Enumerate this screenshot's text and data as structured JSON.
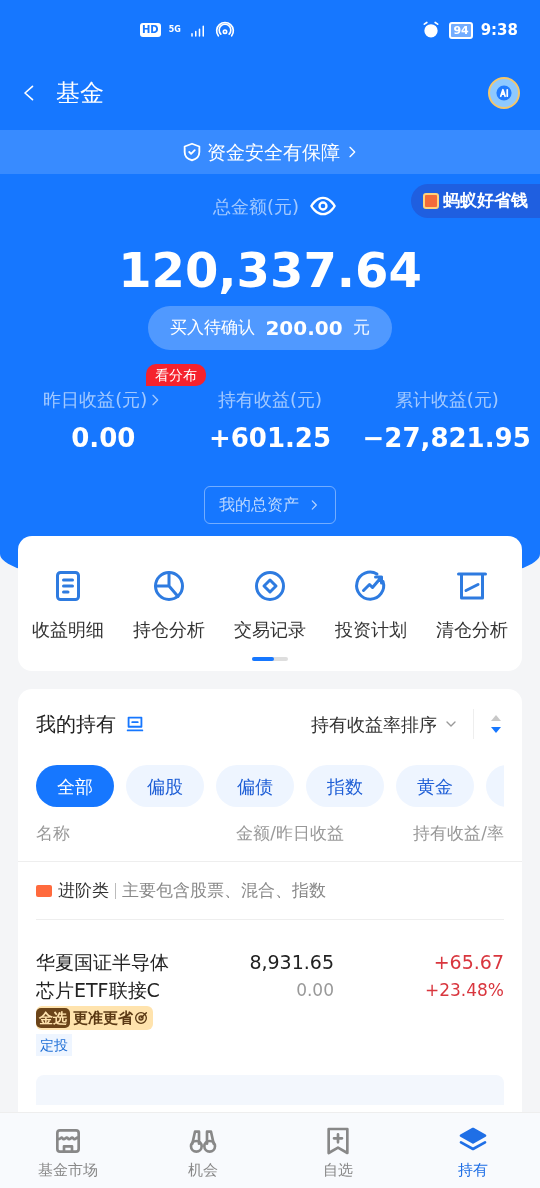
{
  "status_bar": {
    "hd": "HD",
    "network": "5G",
    "battery": "94",
    "time": "9:38"
  },
  "header": {
    "title": "基金"
  },
  "security_banner": {
    "label": "资金安全有保障"
  },
  "summary": {
    "total_label": "总金额(元)",
    "promo": "蚂蚁好省钱",
    "total": "120,337.64",
    "pending_label": "买入待确认",
    "pending_amount": "200.00",
    "pending_unit": "元",
    "badge": "看分布",
    "stats": [
      {
        "label": "昨日收益(元)",
        "value": "0.00",
        "link": true
      },
      {
        "label": "持有收益(元)",
        "value": "+601.25",
        "link": false
      },
      {
        "label": "累计收益(元)",
        "value": "−27,821.95",
        "link": false
      }
    ],
    "assets_button": "我的总资产"
  },
  "shortcuts": [
    {
      "label": "收益明细"
    },
    {
      "label": "持仓分析"
    },
    {
      "label": "交易记录"
    },
    {
      "label": "投资计划"
    },
    {
      "label": "清仓分析"
    }
  ],
  "shortcut_pager": {
    "level": 0.6
  },
  "holdings": {
    "title": "我的持有",
    "sort_label": "持有收益率排序",
    "filters": [
      {
        "label": "全部",
        "selected": true
      },
      {
        "label": "偏股",
        "selected": false
      },
      {
        "label": "偏债",
        "selected": false
      },
      {
        "label": "指数",
        "selected": false
      },
      {
        "label": "黄金",
        "selected": false
      }
    ],
    "columns": [
      "名称",
      "金额/昨日收益",
      "持有收益/率"
    ],
    "category": {
      "name": "进阶类",
      "description": "主要包含股票、混合、指数"
    },
    "funds": [
      {
        "name": "华夏国证半导体芯片ETF联接C",
        "amount": "8,931.65",
        "yesterday": "0.00",
        "profit": "+65.67",
        "rate": "+23.48%",
        "promo_tag": "金选",
        "promo_text": "更准更省",
        "plan_tag": "定投"
      }
    ]
  },
  "bottom_nav": [
    {
      "label": "基金市场",
      "selected": false
    },
    {
      "label": "机会",
      "selected": false
    },
    {
      "label": "自选",
      "selected": false
    },
    {
      "label": "持有",
      "selected": true
    }
  ]
}
